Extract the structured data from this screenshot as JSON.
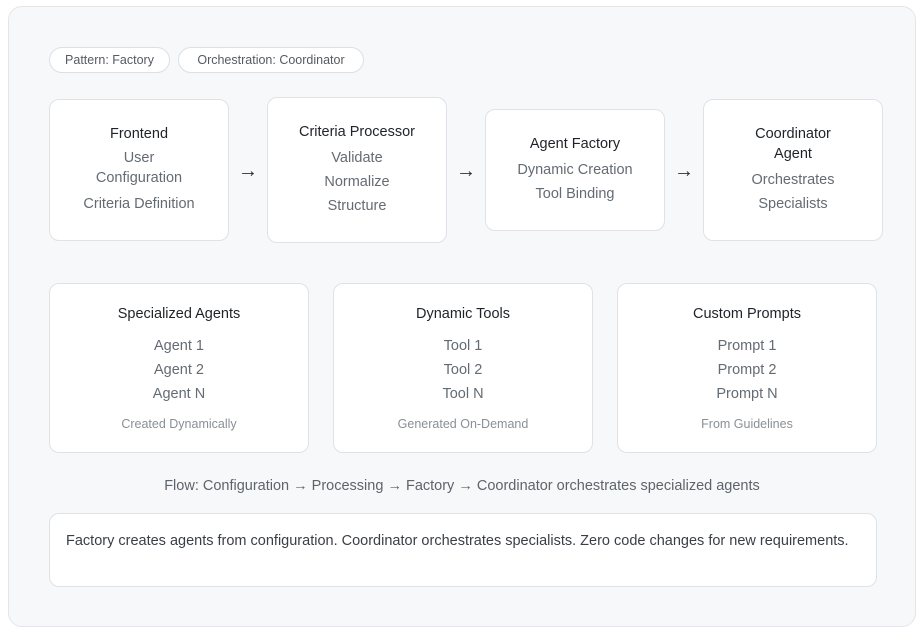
{
  "tags": [
    "Pattern: Factory",
    "Orchestration: Coordinator"
  ],
  "pipeline": [
    {
      "title": "Frontend",
      "lines": [
        "User Configuration",
        "Criteria Definition"
      ]
    },
    {
      "title": "Criteria Processor",
      "lines": [
        "Validate",
        "Normalize",
        "Structure"
      ]
    },
    {
      "title": "Agent Factory",
      "lines": [
        "Dynamic Creation",
        "Tool Binding"
      ]
    },
    {
      "title": "Coordinator Agent",
      "lines": [
        "Orchestrates",
        "Specialists"
      ]
    }
  ],
  "arrow_glyph": "→",
  "components": [
    {
      "title": "Specialized Agents",
      "items": [
        "Agent 1",
        "Agent 2",
        "Agent N"
      ],
      "note": "Created Dynamically"
    },
    {
      "title": "Dynamic Tools",
      "items": [
        "Tool 1",
        "Tool 2",
        "Tool N"
      ],
      "note": "Generated On-Demand"
    },
    {
      "title": "Custom Prompts",
      "items": [
        "Prompt 1",
        "Prompt 2",
        "Prompt N"
      ],
      "note": "From Guidelines"
    }
  ],
  "flow_text": "Flow: Configuration → Processing → Factory → Coordinator orchestrates specialized agents",
  "summary_text": "Factory creates agents from configuration. Coordinator orchestrates specialists. Zero code changes for new requirements."
}
